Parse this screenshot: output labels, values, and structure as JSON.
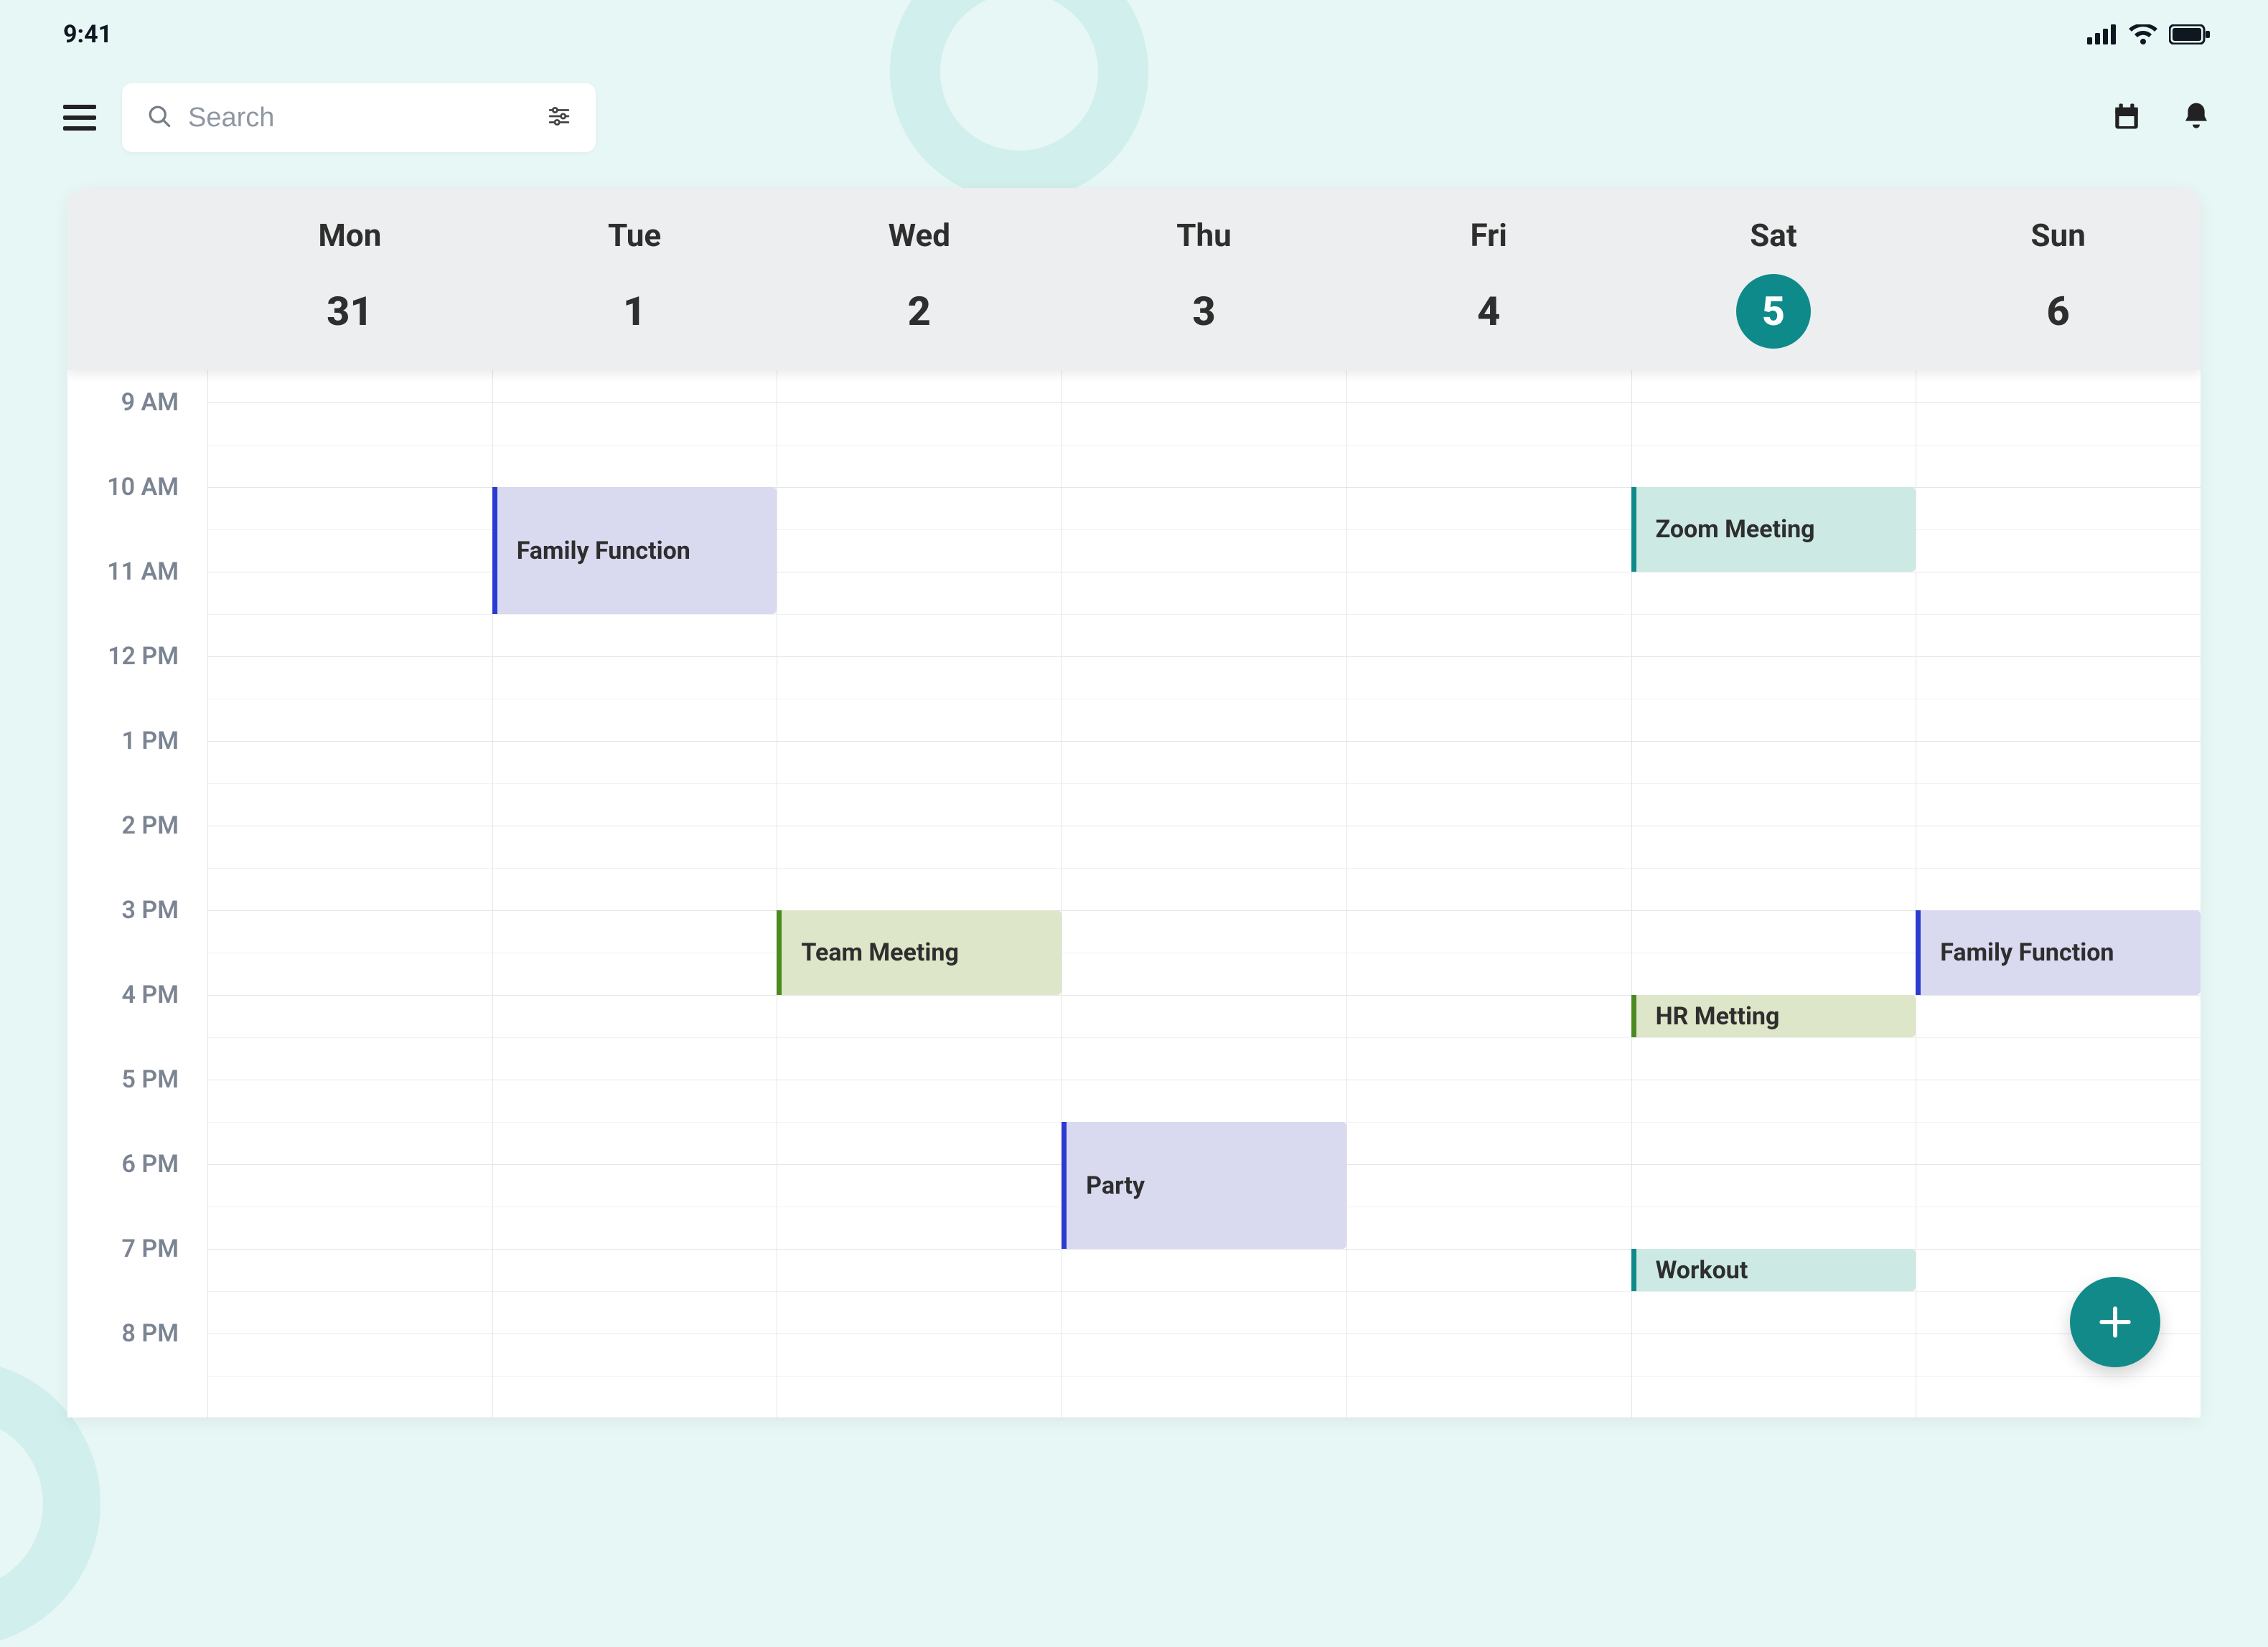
{
  "status": {
    "time": "9:41"
  },
  "search": {
    "placeholder": "Search"
  },
  "hourHeight": 118,
  "gridStartHour": 8.5,
  "days": [
    {
      "dow": "Mon",
      "num": "31",
      "today": false
    },
    {
      "dow": "Tue",
      "num": "1",
      "today": false
    },
    {
      "dow": "Wed",
      "num": "2",
      "today": false
    },
    {
      "dow": "Thu",
      "num": "3",
      "today": false
    },
    {
      "dow": "Fri",
      "num": "4",
      "today": false
    },
    {
      "dow": "Sat",
      "num": "5",
      "today": true
    },
    {
      "dow": "Sun",
      "num": "6",
      "today": false
    }
  ],
  "hours": [
    {
      "h": 9,
      "label": "9 AM"
    },
    {
      "h": 10,
      "label": "10 AM"
    },
    {
      "h": 11,
      "label": "11 AM"
    },
    {
      "h": 12,
      "label": "12 PM"
    },
    {
      "h": 13,
      "label": "1 PM"
    },
    {
      "h": 14,
      "label": "2 PM"
    },
    {
      "h": 15,
      "label": "3 PM"
    },
    {
      "h": 16,
      "label": "4 PM"
    },
    {
      "h": 17,
      "label": "5 PM"
    },
    {
      "h": 18,
      "label": "6 PM"
    },
    {
      "h": 19,
      "label": "7 PM"
    },
    {
      "h": 20,
      "label": "8 PM"
    }
  ],
  "events": [
    {
      "day": 1,
      "start": 10,
      "end": 11.5,
      "title": "Family Function",
      "color": "blue"
    },
    {
      "day": 5,
      "start": 10,
      "end": 11,
      "title": "Zoom Meeting",
      "color": "teal"
    },
    {
      "day": 2,
      "start": 15,
      "end": 16,
      "title": "Team Meeting",
      "color": "green"
    },
    {
      "day": 6,
      "start": 15,
      "end": 16,
      "title": "Family Function",
      "color": "blue"
    },
    {
      "day": 5,
      "start": 16,
      "end": 16.5,
      "title": "HR Metting",
      "color": "green"
    },
    {
      "day": 3,
      "start": 17.5,
      "end": 19,
      "title": "Party",
      "color": "blue"
    },
    {
      "day": 5,
      "start": 19,
      "end": 19.5,
      "title": "Workout",
      "color": "teal"
    }
  ],
  "colors": {
    "accent": "#0f8a8a"
  }
}
